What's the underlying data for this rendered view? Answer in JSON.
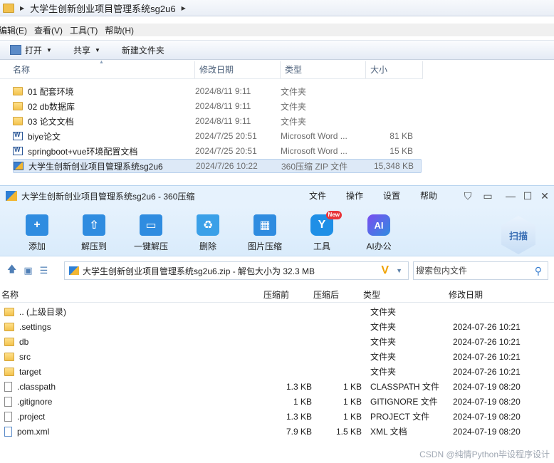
{
  "explorer": {
    "address_path": "大学生创新创业项目管理系统sg2u6",
    "menu": [
      "编辑(E)",
      "查看(V)",
      "工具(T)",
      "帮助(H)"
    ],
    "commands": {
      "open": "打开",
      "share": "共享",
      "new_folder": "新建文件夹"
    },
    "columns": {
      "name": "名称",
      "date": "修改日期",
      "type": "类型",
      "size": "大小"
    },
    "files": [
      {
        "name": "01 配套环境",
        "date": "2024/8/11 9:11",
        "type": "文件夹",
        "size": "",
        "icon": "folder-icon"
      },
      {
        "name": "02 db数据库",
        "date": "2024/8/11 9:11",
        "type": "文件夹",
        "size": "",
        "icon": "folder-icon"
      },
      {
        "name": "03 论文文档",
        "date": "2024/8/11 9:11",
        "type": "文件夹",
        "size": "",
        "icon": "folder-icon"
      },
      {
        "name": "biye论文",
        "date": "2024/7/25 20:51",
        "type": "Microsoft Word ...",
        "size": "81 KB",
        "icon": "word-icon"
      },
      {
        "name": "springboot+vue环境配置文档",
        "date": "2024/7/25 20:51",
        "type": "Microsoft Word ...",
        "size": "15 KB",
        "icon": "word-icon"
      },
      {
        "name": "大学生创新创业项目管理系统sg2u6",
        "date": "2024/7/26 10:22",
        "type": "360压缩 ZIP 文件",
        "size": "15,348 KB",
        "icon": "zip-icon",
        "selected": true
      }
    ]
  },
  "zip_window": {
    "title": "大学生创新创业项目管理系统sg2u6 - 360压缩",
    "menu": [
      "文件",
      "操作",
      "设置",
      "帮助"
    ],
    "toolbar": [
      {
        "label": "添加",
        "icon": "add-icon",
        "glyph": "+"
      },
      {
        "label": "解压到",
        "icon": "extract-to-icon",
        "glyph": "⇧"
      },
      {
        "label": "一键解压",
        "icon": "one-click-extract-icon",
        "glyph": "▭"
      },
      {
        "label": "删除",
        "icon": "trash-icon",
        "glyph": "♻"
      },
      {
        "label": "图片压缩",
        "icon": "image-compress-icon",
        "glyph": "▦"
      },
      {
        "label": "工具",
        "icon": "tools-icon",
        "glyph": "Y",
        "badge": "New"
      },
      {
        "label": "AI办公",
        "icon": "ai-icon",
        "glyph": "AI"
      }
    ],
    "scan_label": "扫描",
    "path": "大学生创新创业项目管理系统sg2u6.zip - 解包大小为 32.3 MB",
    "search_placeholder": "搜索包内文件",
    "columns": {
      "name": "名称",
      "compressed_before": "压缩前",
      "compressed_after": "压缩后",
      "type": "类型",
      "date": "修改日期"
    },
    "files": [
      {
        "name": ".. (上级目录)",
        "before": "",
        "after": "",
        "type": "文件夹",
        "date": "",
        "icon": "folder-icon"
      },
      {
        "name": ".settings",
        "before": "",
        "after": "",
        "type": "文件夹",
        "date": "2024-07-26 10:21",
        "icon": "folder-icon"
      },
      {
        "name": "db",
        "before": "",
        "after": "",
        "type": "文件夹",
        "date": "2024-07-26 10:21",
        "icon": "folder-icon"
      },
      {
        "name": "src",
        "before": "",
        "after": "",
        "type": "文件夹",
        "date": "2024-07-26 10:21",
        "icon": "folder-icon"
      },
      {
        "name": "target",
        "before": "",
        "after": "",
        "type": "文件夹",
        "date": "2024-07-26 10:21",
        "icon": "folder-icon"
      },
      {
        "name": ".classpath",
        "before": "1.3 KB",
        "after": "1 KB",
        "type": "CLASSPATH 文件",
        "date": "2024-07-19 08:20",
        "icon": "file-icon"
      },
      {
        "name": ".gitignore",
        "before": "1 KB",
        "after": "1 KB",
        "type": "GITIGNORE 文件",
        "date": "2024-07-19 08:20",
        "icon": "file-icon"
      },
      {
        "name": ".project",
        "before": "1.3 KB",
        "after": "1 KB",
        "type": "PROJECT 文件",
        "date": "2024-07-19 08:20",
        "icon": "file-icon"
      },
      {
        "name": "pom.xml",
        "before": "7.9 KB",
        "after": "1.5 KB",
        "type": "XML 文档",
        "date": "2024-07-19 08:20",
        "icon": "xml-icon"
      }
    ]
  },
  "watermark": "CSDN @纯情Python毕设程序设计"
}
